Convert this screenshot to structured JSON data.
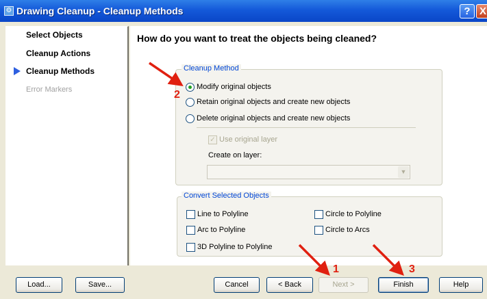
{
  "window": {
    "title": "Drawing Cleanup - Cleanup Methods",
    "help_glyph": "?",
    "close_glyph": "X",
    "app_icon": "⚙"
  },
  "nav": {
    "items": [
      {
        "label": "Select Objects"
      },
      {
        "label": "Cleanup Actions"
      },
      {
        "label": "Cleanup Methods"
      },
      {
        "label": "Error Markers"
      }
    ]
  },
  "main": {
    "question": "How do you want to treat the objects being cleaned?",
    "cleanup_method": {
      "legend": "Cleanup Method",
      "options": [
        {
          "label": "Modify original objects",
          "selected": true
        },
        {
          "label": "Retain original objects and create new objects",
          "selected": false
        },
        {
          "label": "Delete original objects and create new objects",
          "selected": false
        }
      ],
      "use_original_layer": "Use original layer",
      "create_on_layer": "Create on layer:",
      "check_glyph": "✓",
      "combo_arrow": "▼"
    },
    "convert": {
      "legend": "Convert Selected Objects",
      "options": [
        {
          "label": "Line to Polyline"
        },
        {
          "label": "Circle to Polyline"
        },
        {
          "label": "Arc to Polyline"
        },
        {
          "label": "Circle to Arcs"
        },
        {
          "label": "3D Polyline to Polyline"
        }
      ]
    }
  },
  "buttons": {
    "load": "Load...",
    "save": "Save...",
    "cancel": "Cancel",
    "back": "< Back",
    "next": "Next >",
    "finish": "Finish",
    "help": "Help"
  },
  "annotations": {
    "marker_1": "1",
    "marker_2": "2",
    "marker_3": "3",
    "arrow_color": "#e02010"
  }
}
